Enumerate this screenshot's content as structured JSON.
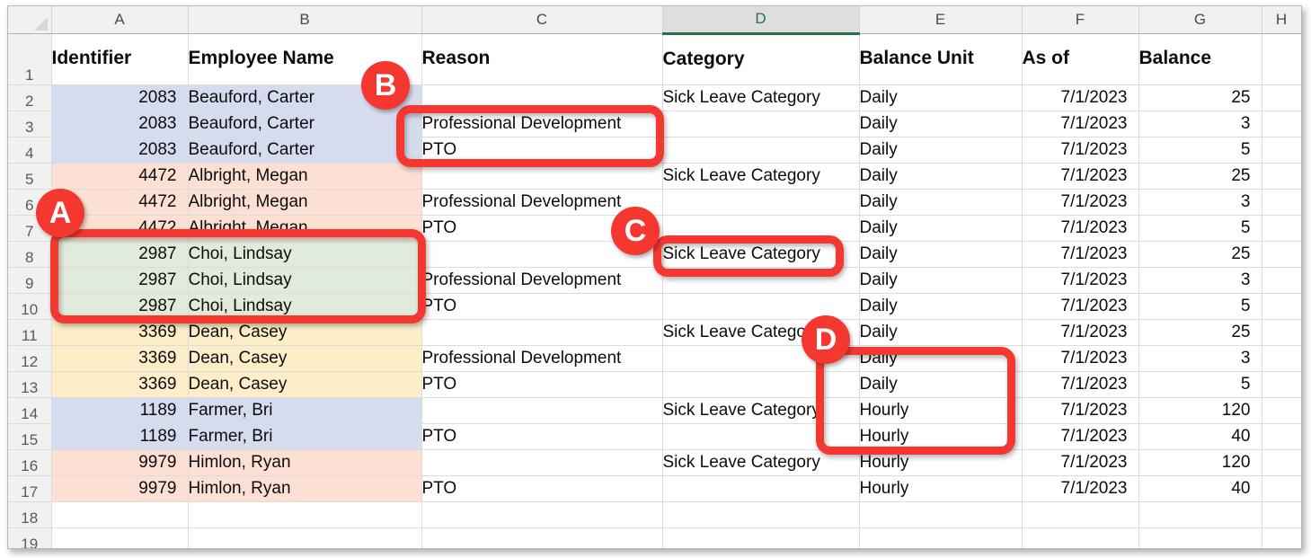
{
  "app": {
    "type": "spreadsheet",
    "accent_color": "#217346",
    "annotation_color": "#f4372f"
  },
  "grid": {
    "column_letters": [
      "A",
      "B",
      "C",
      "D",
      "E",
      "F",
      "G",
      "H"
    ],
    "active_column": "D",
    "row_numbers": [
      "1",
      "2",
      "3",
      "4",
      "5",
      "6",
      "7",
      "8",
      "9",
      "10",
      "11",
      "12",
      "13",
      "14",
      "15",
      "16",
      "17",
      "18",
      "19"
    ],
    "headers": {
      "A": "Identifier",
      "B": "Employee Name",
      "C": "Reason",
      "D": "Category",
      "E": "Balance Unit",
      "F": "As of",
      "G": "Balance",
      "H": ""
    },
    "rows": [
      {
        "row": "2",
        "identifier": "2083",
        "employee_name": "Beauford, Carter",
        "reason": "",
        "category": "Sick Leave Category",
        "balance_unit": "Daily",
        "as_of": "7/1/2023",
        "balance": "25",
        "fill": "#d6dcef"
      },
      {
        "row": "3",
        "identifier": "2083",
        "employee_name": "Beauford, Carter",
        "reason": "Professional Development",
        "category": "",
        "balance_unit": "Daily",
        "as_of": "7/1/2023",
        "balance": "3",
        "fill": "#d6dcef"
      },
      {
        "row": "4",
        "identifier": "2083",
        "employee_name": "Beauford, Carter",
        "reason": "PTO",
        "category": "",
        "balance_unit": "Daily",
        "as_of": "7/1/2023",
        "balance": "5",
        "fill": "#d6dcef"
      },
      {
        "row": "5",
        "identifier": "4472",
        "employee_name": "Albright, Megan",
        "reason": "",
        "category": "Sick Leave Category",
        "balance_unit": "Daily",
        "as_of": "7/1/2023",
        "balance": "25",
        "fill": "#fbe0d3"
      },
      {
        "row": "6",
        "identifier": "4472",
        "employee_name": "Albright, Megan",
        "reason": "Professional Development",
        "category": "",
        "balance_unit": "Daily",
        "as_of": "7/1/2023",
        "balance": "3",
        "fill": "#fbe0d3"
      },
      {
        "row": "7",
        "identifier": "4472",
        "employee_name": "Albright, Megan",
        "reason": "PTO",
        "category": "",
        "balance_unit": "Daily",
        "as_of": "7/1/2023",
        "balance": "5",
        "fill": "#fbe0d3"
      },
      {
        "row": "8",
        "identifier": "2987",
        "employee_name": "Choi, Lindsay",
        "reason": "",
        "category": "Sick Leave Category",
        "balance_unit": "Daily",
        "as_of": "7/1/2023",
        "balance": "25",
        "fill": "#e1ebdb"
      },
      {
        "row": "9",
        "identifier": "2987",
        "employee_name": "Choi, Lindsay",
        "reason": "Professional Development",
        "category": "",
        "balance_unit": "Daily",
        "as_of": "7/1/2023",
        "balance": "3",
        "fill": "#e1ebdb"
      },
      {
        "row": "10",
        "identifier": "2987",
        "employee_name": "Choi, Lindsay",
        "reason": "PTO",
        "category": "",
        "balance_unit": "Daily",
        "as_of": "7/1/2023",
        "balance": "5",
        "fill": "#e1ebdb"
      },
      {
        "row": "11",
        "identifier": "3369",
        "employee_name": "Dean, Casey",
        "reason": "",
        "category": "Sick Leave Category",
        "balance_unit": "Daily",
        "as_of": "7/1/2023",
        "balance": "25",
        "fill": "#fdeec9"
      },
      {
        "row": "12",
        "identifier": "3369",
        "employee_name": "Dean, Casey",
        "reason": "Professional Development",
        "category": "",
        "balance_unit": "Daily",
        "as_of": "7/1/2023",
        "balance": "3",
        "fill": "#fdeec9"
      },
      {
        "row": "13",
        "identifier": "3369",
        "employee_name": "Dean, Casey",
        "reason": "PTO",
        "category": "",
        "balance_unit": "Daily",
        "as_of": "7/1/2023",
        "balance": "5",
        "fill": "#fdeec9"
      },
      {
        "row": "14",
        "identifier": "1189",
        "employee_name": "Farmer, Bri",
        "reason": "",
        "category": "Sick Leave Category",
        "balance_unit": "Hourly",
        "as_of": "7/1/2023",
        "balance": "120",
        "fill": "#d6dcef"
      },
      {
        "row": "15",
        "identifier": "1189",
        "employee_name": "Farmer, Bri",
        "reason": "PTO",
        "category": "",
        "balance_unit": "Hourly",
        "as_of": "7/1/2023",
        "balance": "40",
        "fill": "#d6dcef"
      },
      {
        "row": "16",
        "identifier": "9979",
        "employee_name": "Himlon, Ryan",
        "reason": "",
        "category": "Sick Leave Category",
        "balance_unit": "Hourly",
        "as_of": "7/1/2023",
        "balance": "120",
        "fill": "#fbe0d3"
      },
      {
        "row": "17",
        "identifier": "9979",
        "employee_name": "Himlon, Ryan",
        "reason": "PTO",
        "category": "",
        "balance_unit": "Hourly",
        "as_of": "7/1/2023",
        "balance": "40",
        "fill": "#fbe0d3"
      },
      {
        "row": "18",
        "identifier": "",
        "employee_name": "",
        "reason": "",
        "category": "",
        "balance_unit": "",
        "as_of": "",
        "balance": "",
        "fill": "#ffffff"
      },
      {
        "row": "19",
        "identifier": "",
        "employee_name": "",
        "reason": "",
        "category": "",
        "balance_unit": "",
        "as_of": "",
        "balance": "",
        "fill": "#ffffff"
      }
    ]
  },
  "annotations": [
    {
      "id": "A",
      "label": "A",
      "target": "employee-rows-8-10"
    },
    {
      "id": "B",
      "label": "B",
      "target": "reason-cells-rows-3-4"
    },
    {
      "id": "C",
      "label": "C",
      "target": "category-cell-row-8"
    },
    {
      "id": "D",
      "label": "D",
      "target": "balance-unit-cells-rows-12-15"
    }
  ]
}
